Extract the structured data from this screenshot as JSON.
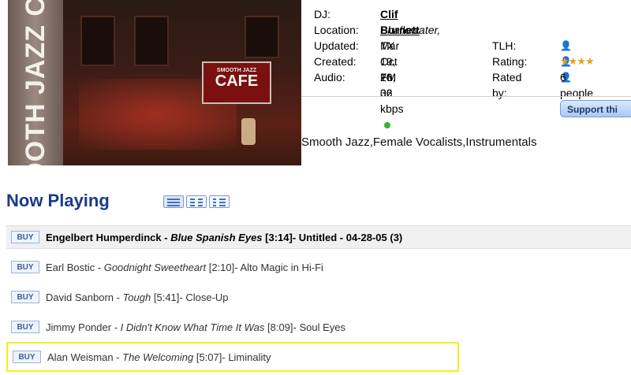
{
  "station": {
    "image_text": "SMOOTH JAZZ CAFE",
    "sign_small": "SMOOTH JAZZ",
    "sign_big": "CAFE",
    "dj_label": "DJ:",
    "dj_value": "Clif Burnett",
    "location_label": "Location:",
    "location_value": "Shallowater, TX",
    "updated_label": "Updated:",
    "updated_value": "Mar 19, 10",
    "created_label": "Created:",
    "created_value": "Oct 26, 06",
    "audio_label": "Audio:",
    "audio_value": "FM 32 kbps",
    "tlh_label": "TLH:",
    "tlh_icon": "people-icon",
    "rating_label": "Rating:",
    "rating_value": "★★★★",
    "rated_by_label": "Rated by:",
    "rated_by_value": "6 people",
    "support_button": "Support thi",
    "genres": "Smooth Jazz,Female Vocalists,Instrumentals"
  },
  "now_playing": {
    "title": "Now Playing",
    "buy_label": "BUY",
    "tracks": [
      {
        "artist": "Engelbert Humperdinck",
        "song": "Blue Spanish Eyes",
        "length": "[3:14]",
        "rest": " - Untitled - 04-28-05 (3)"
      },
      {
        "artist": "Earl Bostic",
        "song": "Goodnight Sweetheart",
        "length": "[2:10]",
        "rest": " - Alto Magic in Hi-Fi"
      },
      {
        "artist": "David Sanborn",
        "song": "Tough",
        "length": "[5:41]",
        "rest": " - Close-Up"
      },
      {
        "artist": "Jimmy Ponder",
        "song": "I Didn't Know What Time It Was",
        "length": "[8:09]",
        "rest": " - Soul Eyes"
      },
      {
        "artist": "Alan Weisman",
        "song": "The Welcoming",
        "length": "[5:07]",
        "rest": " - Liminality"
      }
    ]
  },
  "colors": {
    "title_blue": "#1a3a8a",
    "highlight_yellow": "#f0f020",
    "audio_dot_green": "#2eb82e"
  }
}
